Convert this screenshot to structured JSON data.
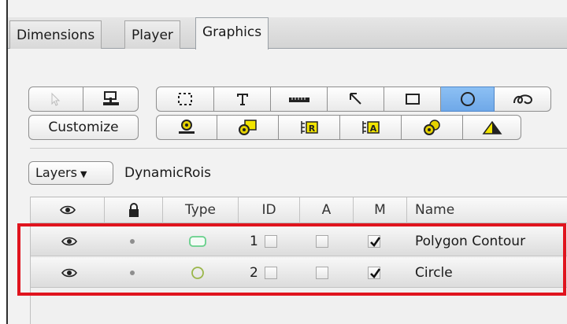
{
  "tabs": [
    {
      "label": "Dimensions"
    },
    {
      "label": "Player"
    },
    {
      "label": "Graphics",
      "active": true
    }
  ],
  "toolbar": {
    "row1_tools": [
      "select-arrow",
      "stamp-tool",
      "dashed-rect-selection",
      "text-tool",
      "ruler-tool",
      "arrow-tool",
      "rectangle-tool",
      "ellipse-tool",
      "freehand-tool"
    ],
    "active_tool": "ellipse-tool",
    "customize_label": "Customize",
    "row2_tools": [
      "calibration-tool",
      "roi-define-tool",
      "roi-r-tool",
      "roi-a-tool",
      "roi-track-tool",
      "threshold-tool"
    ]
  },
  "layers": {
    "button_label": "Layers",
    "current": "DynamicRois"
  },
  "table": {
    "columns": {
      "type": "Type",
      "id": "ID",
      "a": "A",
      "m": "M",
      "name": "Name"
    },
    "rows": [
      {
        "visible": true,
        "locked": false,
        "type_icon": "polygon-contour",
        "id": "1",
        "id_checked": false,
        "a_checked": false,
        "m_checked": true,
        "name": "Polygon Contour"
      },
      {
        "visible": true,
        "locked": false,
        "type_icon": "circle",
        "id": "2",
        "id_checked": false,
        "a_checked": false,
        "m_checked": true,
        "name": "Circle"
      }
    ]
  },
  "colors": {
    "highlight": "#e0141e",
    "active_tool": "#7fb4ef",
    "polygon_icon": "#66d08a",
    "circle_icon": "#9ab64a"
  }
}
